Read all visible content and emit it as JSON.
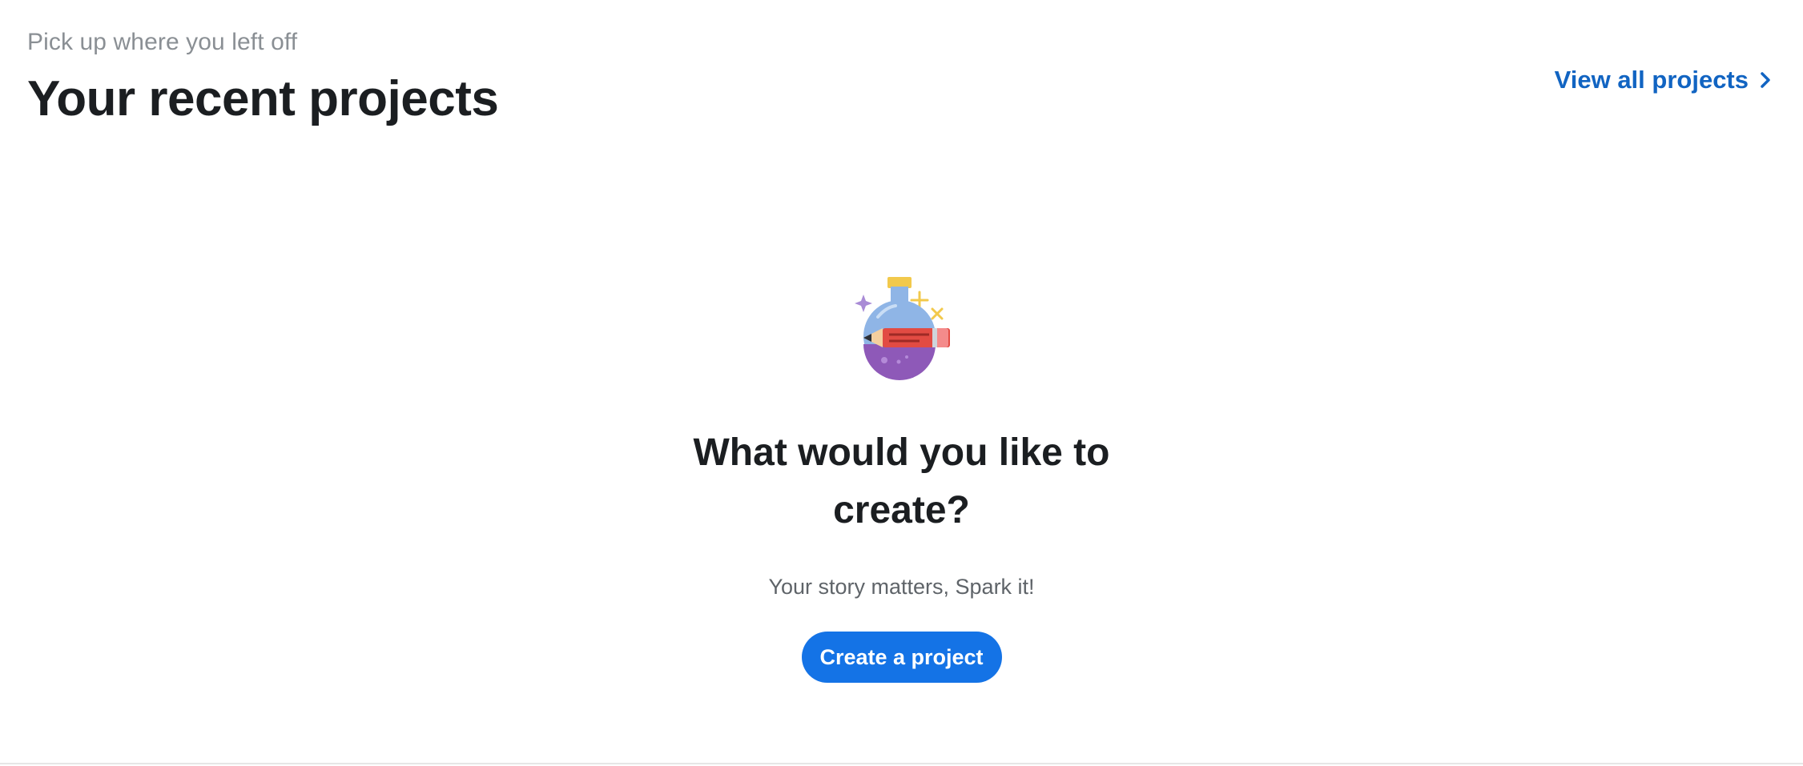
{
  "header": {
    "eyebrow": "Pick up where you left off",
    "title": "Your recent projects",
    "view_all_label": "View all projects"
  },
  "empty_state": {
    "illustration": "potion-flask-with-pencil-icon",
    "title": "What would you like to create?",
    "subtitle": "Your story matters, Spark it!",
    "cta_label": "Create a project"
  },
  "colors": {
    "link": "#1164c2",
    "button": "#1473e6",
    "heading": "#1b1e21",
    "muted": "#8a8f94"
  }
}
